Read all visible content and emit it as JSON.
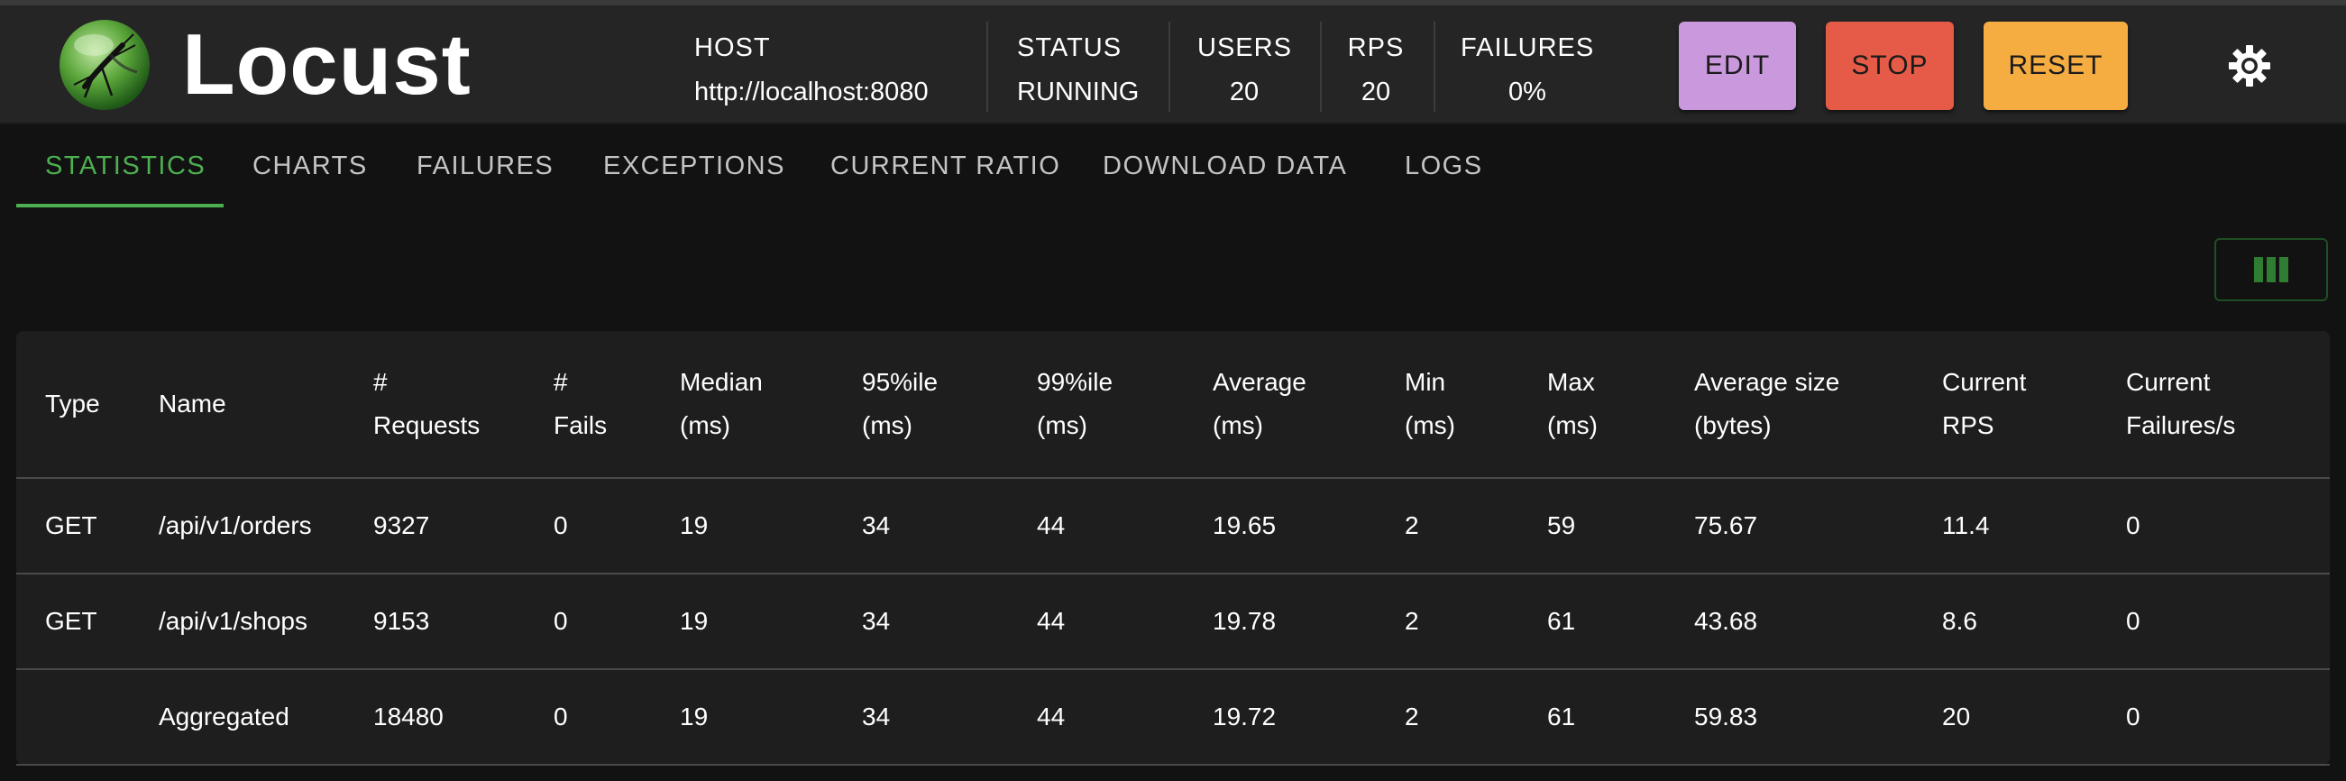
{
  "app": {
    "brand": "Locust"
  },
  "header": {
    "stats": {
      "host": {
        "label": "HOST",
        "value": "http://localhost:8080"
      },
      "status": {
        "label": "STATUS",
        "value": "RUNNING"
      },
      "users": {
        "label": "USERS",
        "value": "20"
      },
      "rps": {
        "label": "RPS",
        "value": "20"
      },
      "failures": {
        "label": "FAILURES",
        "value": "0%"
      }
    },
    "buttons": {
      "edit": "EDIT",
      "stop": "STOP",
      "reset": "RESET"
    },
    "colors": {
      "edit": "#c998dd",
      "stop": "#e55b47",
      "reset": "#f5ad42",
      "accent": "#4caf50"
    },
    "theme_icon": "brightness-gear-icon"
  },
  "tabs": [
    {
      "label": "STATISTICS",
      "active": true
    },
    {
      "label": "CHARTS"
    },
    {
      "label": "FAILURES"
    },
    {
      "label": "EXCEPTIONS"
    },
    {
      "label": "CURRENT RATIO"
    },
    {
      "label": "DOWNLOAD DATA"
    },
    {
      "label": "LOGS"
    }
  ],
  "toolbar": {
    "columns_icon": "view-column-icon"
  },
  "table": {
    "headers": [
      {
        "l1": "Type",
        "l2": ""
      },
      {
        "l1": "Name",
        "l2": ""
      },
      {
        "l1": "#",
        "l2": "Requests"
      },
      {
        "l1": "#",
        "l2": "Fails"
      },
      {
        "l1": "Median",
        "l2": "(ms)"
      },
      {
        "l1": "95%ile",
        "l2": "(ms)"
      },
      {
        "l1": "99%ile",
        "l2": "(ms)"
      },
      {
        "l1": "Average",
        "l2": "(ms)"
      },
      {
        "l1": "Min",
        "l2": "(ms)"
      },
      {
        "l1": "Max",
        "l2": "(ms)"
      },
      {
        "l1": "Average size",
        "l2": "(bytes)"
      },
      {
        "l1": "Current",
        "l2": "RPS"
      },
      {
        "l1": "Current",
        "l2": "Failures/s"
      }
    ],
    "rows": [
      [
        "GET",
        "/api/v1/orders",
        "9327",
        "0",
        "19",
        "34",
        "44",
        "19.65",
        "2",
        "59",
        "75.67",
        "11.4",
        "0"
      ],
      [
        "GET",
        "/api/v1/shops",
        "9153",
        "0",
        "19",
        "34",
        "44",
        "19.78",
        "2",
        "61",
        "43.68",
        "8.6",
        "0"
      ],
      [
        "",
        "Aggregated",
        "18480",
        "0",
        "19",
        "34",
        "44",
        "19.72",
        "2",
        "61",
        "59.83",
        "20",
        "0"
      ]
    ]
  }
}
